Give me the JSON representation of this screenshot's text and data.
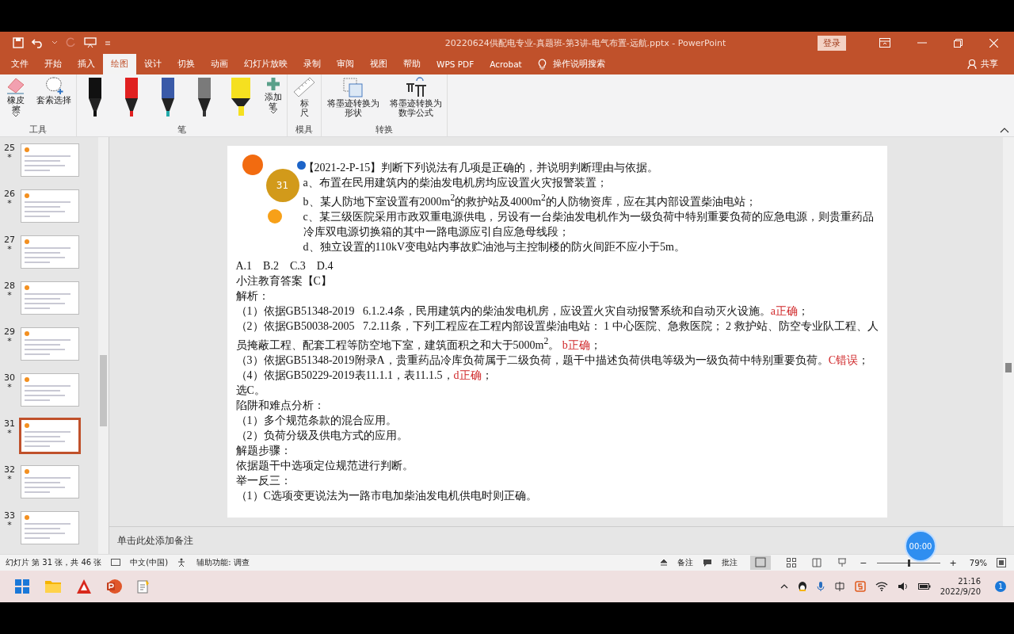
{
  "window": {
    "title": "20220624供配电专业-真题班-第3讲-电气布置-远航.pptx  -  PowerPoint",
    "sign_in": "登录",
    "share": "共享"
  },
  "tabs": [
    {
      "label": "文件",
      "selected": false
    },
    {
      "label": "开始",
      "selected": false
    },
    {
      "label": "插入",
      "selected": false
    },
    {
      "label": "绘图",
      "selected": true
    },
    {
      "label": "设计",
      "selected": false
    },
    {
      "label": "切换",
      "selected": false
    },
    {
      "label": "动画",
      "selected": false
    },
    {
      "label": "幻灯片放映",
      "selected": false
    },
    {
      "label": "录制",
      "selected": false
    },
    {
      "label": "审阅",
      "selected": false
    },
    {
      "label": "视图",
      "selected": false
    },
    {
      "label": "帮助",
      "selected": false
    },
    {
      "label": "WPS PDF",
      "selected": false
    },
    {
      "label": "Acrobat",
      "selected": false
    }
  ],
  "tell_me": "操作说明搜索",
  "ribbon_groups": [
    {
      "label": "工具",
      "items": [
        {
          "kind": "eraser",
          "label": "橡皮擦",
          "dropdown": true
        },
        {
          "kind": "lasso",
          "label": "套索选择",
          "dropdown": false
        }
      ]
    },
    {
      "label": "笔",
      "items": [
        {
          "kind": "pen",
          "color": "#111111"
        },
        {
          "kind": "pen",
          "color": "#e02020"
        },
        {
          "kind": "galaxy",
          "color": "#3a5aa8"
        },
        {
          "kind": "pencil",
          "color": "#7a7a7a"
        },
        {
          "kind": "highlighter",
          "color": "#f5e020"
        },
        {
          "kind": "add",
          "label": "添加笔",
          "dropdown": true
        }
      ]
    },
    {
      "label": "模具",
      "items": [
        {
          "kind": "ruler",
          "label": "标尺",
          "dropdown": false
        }
      ]
    },
    {
      "label": "转换",
      "items": [
        {
          "kind": "shape",
          "label": "将墨迹转换为形状",
          "dropdown": false
        },
        {
          "kind": "math",
          "label": "将墨迹转换为数学公式",
          "dropdown": false
        }
      ]
    }
  ],
  "thumbnails": [
    {
      "number": "25",
      "mark": "*",
      "selected": false
    },
    {
      "number": "26",
      "mark": "*",
      "selected": false
    },
    {
      "number": "27",
      "mark": "*",
      "selected": false
    },
    {
      "number": "28",
      "mark": "*",
      "selected": false
    },
    {
      "number": "29",
      "mark": "*",
      "selected": false
    },
    {
      "number": "30",
      "mark": "*",
      "selected": false
    },
    {
      "number": "31",
      "mark": "*",
      "selected": true
    },
    {
      "number": "32",
      "mark": "*",
      "selected": false
    },
    {
      "number": "33",
      "mark": "*",
      "selected": false
    }
  ],
  "slide": {
    "badge": "31",
    "question": [
      {
        "parts": [
          {
            "text": "【2021-2-P-15】判断下列说法有几项是正确的，并说明判断理由与依据。",
            "emphasis": false
          }
        ]
      },
      {
        "parts": [
          {
            "text": "a、布置在民用建筑内的柴油发电机房均应设置火灾报警装置；",
            "emphasis": false
          }
        ]
      },
      {
        "parts": [
          {
            "text": "b、某人防地下室设置有2000m$^{2}$的救护站及4000m$^{2}$的人防物资库，应在其内部设置柴油电站；",
            "emphasis": false
          }
        ]
      },
      {
        "parts": [
          {
            "text": "c、某三级医院采用市政双重电源供电，另设有一台柴油发电机作为一级负荷中特别重要负荷的应急电源，则贵重药品冷库双电源切换箱的其中一路电源应引自应急母线段；",
            "emphasis": false
          }
        ]
      },
      {
        "parts": [
          {
            "text": "d、独立设置的110kV变电站内事故贮油池与主控制楼的防火间距不应小于5m。",
            "emphasis": false
          }
        ]
      }
    ],
    "body": [
      {
        "parts": [
          {
            "text": "A.1    B.2    C.3    D.4",
            "emphasis": false
          }
        ]
      },
      {
        "parts": [
          {
            "text": "小注教育答案【C】",
            "emphasis": false
          }
        ]
      },
      {
        "parts": [
          {
            "text": "解析：",
            "emphasis": false
          }
        ]
      },
      {
        "parts": [
          {
            "text": "（1）依据GB51348-2019   6.1.2.4条，民用建筑内的柴油发电机房，应设置火灾自动报警系统和自动灭火设施。",
            "emphasis": false
          },
          {
            "text": "a正确",
            "emphasis": true
          },
          {
            "text": "；",
            "emphasis": false
          }
        ]
      },
      {
        "parts": [
          {
            "text": "（2）依据GB50038-2005   7.2.11条，下列工程应在工程内部设置柴油电站： 1 中心医院、急救医院； 2 救护站、防空专业队工程、人员掩蔽工程、配套工程等防空地下室，建筑面积之和大于5000m$^{2}$。 ",
            "emphasis": false
          },
          {
            "text": "b正确",
            "emphasis": true
          },
          {
            "text": "；",
            "emphasis": false
          }
        ]
      },
      {
        "parts": [
          {
            "text": "（3）依据GB51348-2019附录A，贵重药品冷库负荷属于二级负荷，题干中描述负荷供电等级为一级负荷中特别重要负荷。",
            "emphasis": false
          },
          {
            "text": "C错误",
            "emphasis": true
          },
          {
            "text": "；",
            "emphasis": false
          }
        ]
      },
      {
        "parts": [
          {
            "text": "（4）依据GB50229-2019表11.1.1，表11.1.5，",
            "emphasis": false
          },
          {
            "text": "d正确",
            "emphasis": true
          },
          {
            "text": "；",
            "emphasis": false
          }
        ]
      },
      {
        "parts": [
          {
            "text": "选C。",
            "emphasis": false
          }
        ]
      },
      {
        "parts": [
          {
            "text": "陷阱和难点分析：",
            "emphasis": false
          }
        ]
      },
      {
        "parts": [
          {
            "text": "（1）多个规范条款的混合应用。",
            "emphasis": false
          }
        ]
      },
      {
        "parts": [
          {
            "text": "（2）负荷分级及供电方式的应用。",
            "emphasis": false
          }
        ]
      },
      {
        "parts": [
          {
            "text": "解题步骤：",
            "emphasis": false
          }
        ]
      },
      {
        "parts": [
          {
            "text": "依据题干中选项定位规范进行判断。",
            "emphasis": false
          }
        ]
      },
      {
        "parts": [
          {
            "text": "举一反三：",
            "emphasis": false
          }
        ]
      },
      {
        "parts": [
          {
            "text": "（1）C选项变更说法为一路市电加柴油发电机供电时则正确。",
            "emphasis": false
          }
        ]
      }
    ]
  },
  "notes_placeholder": "单击此处添加备注",
  "timer": "00:00",
  "status_bar": {
    "slide_info": "幻灯片 第 31 张，共 46 张",
    "language": "中文(中国)",
    "accessibility": "辅助功能: 调查",
    "notes": "备注",
    "comments": "批注",
    "zoom_out": "−",
    "zoom_in": "+",
    "zoom_level": {
      "level": 0.5
    },
    "zoom": "79%"
  },
  "taskbar": {
    "time": "21:16",
    "date": "2022/9/20",
    "notifications": "1"
  }
}
